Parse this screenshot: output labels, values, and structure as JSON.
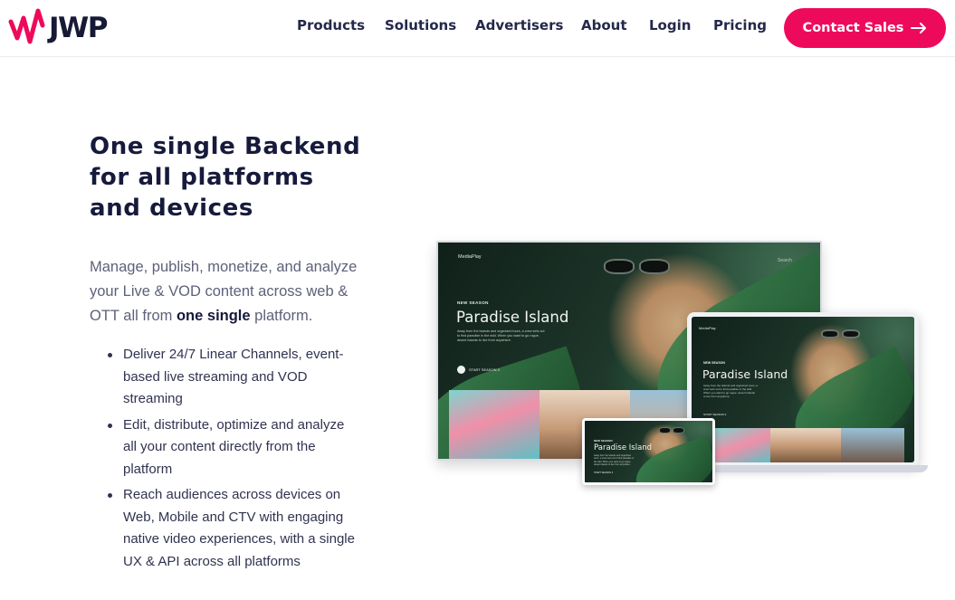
{
  "brand": {
    "name": "JWP",
    "accent": "#ee0a5b"
  },
  "nav": {
    "links": [
      "Products",
      "Solutions",
      "Advertisers",
      "About",
      "Login",
      "Pricing"
    ],
    "cta_label": "Contact Sales",
    "cta_icon": "arrow-right-icon"
  },
  "hero": {
    "headline": "One single Backend for all platforms and devices",
    "intro_before": "Manage, publish, monetize, and analyze your Live & VOD content across web & OTT all from ",
    "intro_bold": "one single",
    "intro_after": " platform.",
    "bullets": [
      "Deliver 24/7 Linear Channels, event-based live streaming and VOD streaming",
      "Edit, distribute, optimize and analyze all your content directly from the platform",
      "Reach audiences across devices on Web, Mobile and CTV with engaging native video experiences, with a single UX & API across all platforms"
    ]
  },
  "mockup": {
    "brand": "MediaPlay",
    "search": "Search",
    "season_tag": "NEW SEASON",
    "show_title": "Paradise Island",
    "description": "Away from the islands and organized tours, a crew sets out to find paradise in the wild. When you want to go rogue, desert islands to live from anywhere.",
    "play_label": "START SEASON 3"
  }
}
